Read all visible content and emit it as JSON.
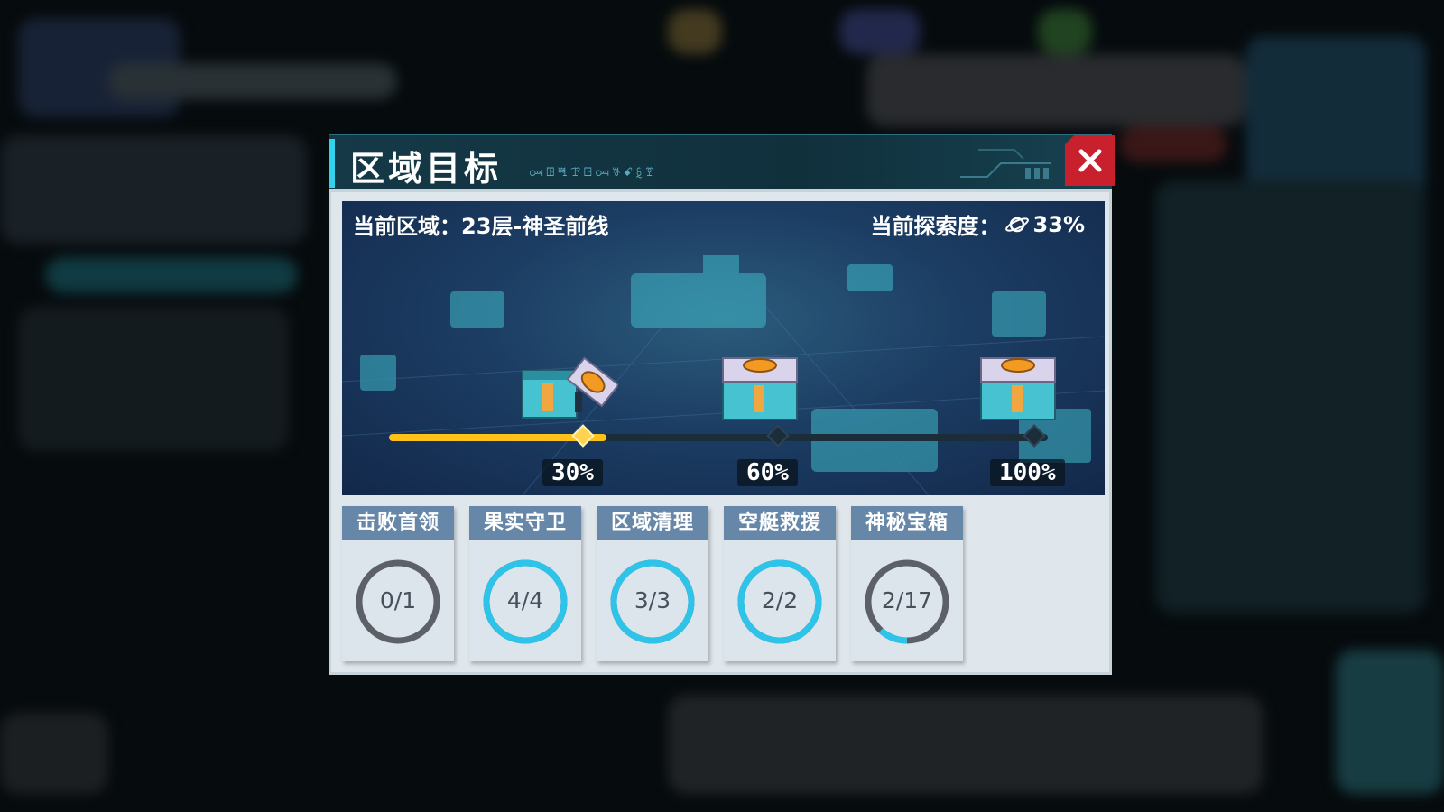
{
  "dialog": {
    "title": "区域目标",
    "subtitle": "ꗢꖸꖽꘘꖸꗢꗎꗃꗐꗑ",
    "close_icon": "close-icon",
    "accent_color": "#33d3ee",
    "close_color": "#c8212d"
  },
  "banner": {
    "region_label": "当前区域：23层-神圣前线",
    "exploration_label": "当前探索度：",
    "exploration_icon": "planet-icon",
    "exploration_value": "33%",
    "exploration_progress": 0.33,
    "progress_color": "#ffc21a",
    "milestones": [
      {
        "label": "30%",
        "reached": true,
        "chest_state": "opened"
      },
      {
        "label": "60%",
        "reached": false,
        "chest_state": "closed"
      },
      {
        "label": "100%",
        "reached": false,
        "chest_state": "closed"
      }
    ]
  },
  "objectives": [
    {
      "title": "击败首领",
      "count": "0/1",
      "progress": 0.0
    },
    {
      "title": "果实守卫",
      "count": "4/4",
      "progress": 1.0
    },
    {
      "title": "区域清理",
      "count": "3/3",
      "progress": 1.0
    },
    {
      "title": "空艇救援",
      "count": "2/2",
      "progress": 1.0
    },
    {
      "title": "神秘宝箱",
      "count": "2/17",
      "progress": 0.1176
    }
  ]
}
